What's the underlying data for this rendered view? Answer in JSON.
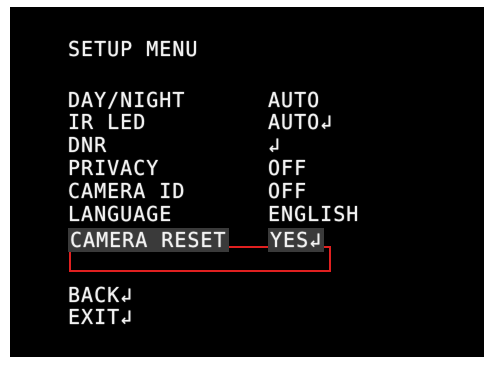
{
  "menu": {
    "title": "SETUP MENU",
    "items": [
      {
        "label": "DAY/NIGHT",
        "value": "AUTO"
      },
      {
        "label": "IR LED",
        "value": "AUTO↲"
      },
      {
        "label": "DNR",
        "value": "↲"
      },
      {
        "label": "PRIVACY",
        "value": "OFF"
      },
      {
        "label": "CAMERA ID",
        "value": "OFF"
      },
      {
        "label": "LANGUAGE",
        "value": "ENGLISH"
      },
      {
        "label": "CAMERA RESET",
        "value": "YES↲"
      }
    ],
    "selected_index": 6,
    "back": "BACK↲",
    "exit": "EXIT↲"
  },
  "colors": {
    "background": "#000000",
    "text": "#f2f2f2",
    "highlight_border": "#e02020",
    "selected_bg": "#3a3a3a"
  }
}
